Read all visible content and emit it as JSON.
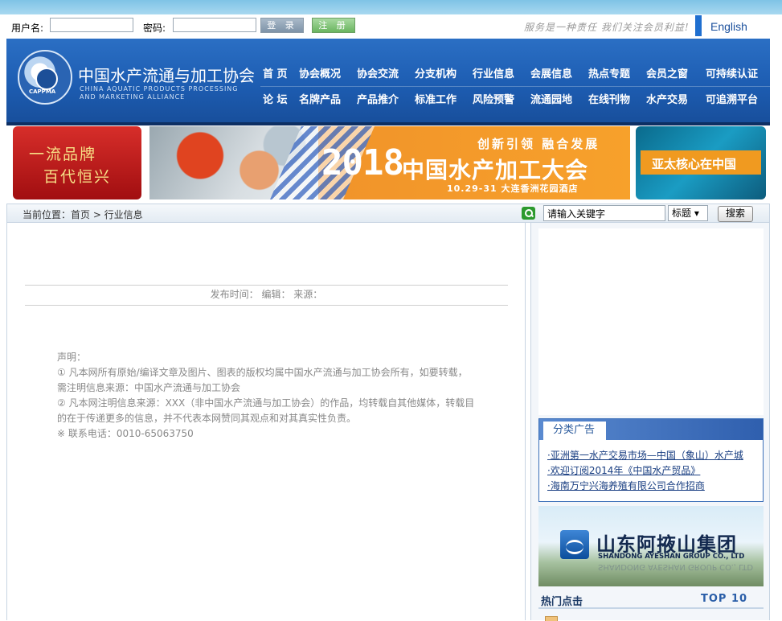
{
  "login": {
    "username_label": "用户名:",
    "username_value": "",
    "password_label": "密码:",
    "password_value": "",
    "login_button": "登 录",
    "register_button": "注 册",
    "slogan": "服务是一种责任 我们关注会员利益!",
    "english_link": "English"
  },
  "header": {
    "org_name_cn": "中国水产流通与加工协会",
    "org_name_en_1": "CHINA AQUATIC PRODUCTS PROCESSING",
    "org_name_en_2": "AND MARKETING ALLIANCE",
    "logo_caption": "CAPPMA",
    "nav_row1": [
      "首 页",
      "协会概况",
      "协会交流",
      "分支机构",
      "行业信息",
      "会展信息",
      "热点专题",
      "会员之窗",
      "可持续认证"
    ],
    "nav_row2": [
      "论 坛",
      "名牌产品",
      "产品推介",
      "标准工作",
      "风险预警",
      "流通园地",
      "在线刊物",
      "水产交易",
      "可追溯平台"
    ]
  },
  "banners": {
    "left_line1": "一流品牌",
    "left_line2": "百代恒兴",
    "main_top": "创新引领 融合发展",
    "main_year": "2018",
    "main_title": "中国水产加工大会",
    "main_date": "10.29-31 大连香洲花园酒店",
    "right_text": "亚太核心在中国"
  },
  "breadcrumb": {
    "label": "当前位置：首页 > 行业信息",
    "search_placeholder": "请输入关键字",
    "search_scope": "标题 ▾",
    "search_button": "搜索"
  },
  "article": {
    "publish_line": "发布时间：  编辑：  来源：",
    "declaration": [
      "声明：",
      "① 凡本网所有原始/编译文章及图片、图表的版权均属中国水产流通与加工协会所有，如要转载，",
      "需注明信息来源：中国水产流通与加工协会",
      "② 凡本网注明信息来源：XXX（非中国水产流通与加工协会）的作品，均转载自其他媒体，转载目",
      "的在于传递更多的信息，并不代表本网赞同其观点和对其真实性负责。",
      "※ 联系电话：0010-65063750"
    ]
  },
  "sidebar": {
    "ads_title": "分类广告",
    "ads": [
      "·亚洲第一水产交易市场—中国（象山）水产城",
      "·欢迎订阅2014年《中国水产贸品》",
      "·海南万宁兴海养殖有限公司合作招商"
    ],
    "logo_cn": "山东阿掖山集团",
    "logo_en": "SHANDONG AYESHAN GROUP CO., LTD",
    "hot_title": "热门点击",
    "hot_top": "TOP 10"
  },
  "colors": {
    "header_blue": "#1d5db2",
    "nav_text": "#ffffff",
    "banner_orange": "#f09a20",
    "link_blue": "#1a3f82"
  }
}
